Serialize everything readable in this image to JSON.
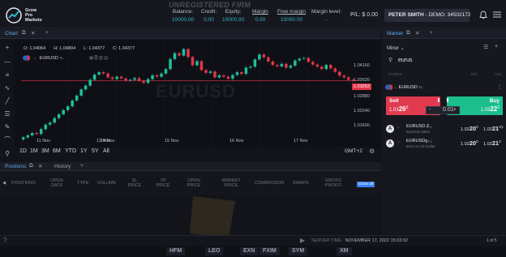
{
  "header": {
    "logo_text": [
      "Grow",
      "Pro",
      "Markets"
    ],
    "watermark": "UNREGISTERED FIRM",
    "stats": [
      {
        "label": "Balance:",
        "value": "10000.00"
      },
      {
        "label": "Credit:",
        "value": "0.00"
      },
      {
        "label": "Equity:",
        "value": "10000.00"
      },
      {
        "label": "Margin",
        "value": "0.00"
      },
      {
        "label": "Free margin",
        "value": "10000.00"
      },
      {
        "label": "Margin level:",
        "value": "-"
      }
    ],
    "pl_label": "P/L:",
    "pl_value": "$ 0.00",
    "account_name": "PETER SMITH",
    "account_sep": " - ",
    "account_type": "DEMO: 34502172"
  },
  "chart_panel": {
    "tab_label": "Chart",
    "ohlc": {
      "o": "O: 1.04064",
      "h": "H: 1.04804",
      "l": "L: 1.04377",
      "c": "C: 1.04377"
    },
    "symbol": "EURUSD",
    "symbol_suffix": "FL",
    "watermark": "EURUSD",
    "current_price": "1.03263",
    "timeframes": [
      "1D",
      "1M",
      "3M",
      "6M",
      "YTD",
      "1Y",
      "5Y",
      "All"
    ],
    "timezone": "GMT+2"
  },
  "chart_data": {
    "type": "candlestick",
    "yticks": [
      "1.04160",
      "1.03520",
      "1.02880",
      "1.02240",
      "1.01600"
    ],
    "xticks": [
      "11 Nov",
      "13 Nov",
      "14 Nov",
      "15 Nov",
      "16 Nov",
      "17 Nov"
    ],
    "ylim": [
      1.0135,
      1.0445
    ],
    "current_price": 1.03263,
    "close_series": [
      1.0162,
      1.0168,
      1.0175,
      1.0172,
      1.0186,
      1.0199,
      1.0205,
      1.0218,
      1.0229,
      1.0241,
      1.0252,
      1.0269,
      1.0283,
      1.0301,
      1.0312,
      1.0329,
      1.0344,
      1.0351,
      1.0347,
      1.0336,
      1.0331,
      1.0338,
      1.0333,
      1.0327,
      1.0329,
      1.0334,
      1.0326,
      1.032,
      1.0331,
      1.0342,
      1.0338,
      1.0347,
      1.036,
      1.0389,
      1.0406,
      1.0399,
      1.0418,
      1.0395,
      1.0371,
      1.0383,
      1.0357,
      1.0349,
      1.0353,
      1.0336,
      1.0342,
      1.0338,
      1.0332,
      1.0343,
      1.0351,
      1.0346,
      1.0364,
      1.0367,
      1.0388,
      1.0402,
      1.0394,
      1.0382,
      1.0372,
      1.0368,
      1.0375,
      1.0364,
      1.037,
      1.0385,
      1.039,
      1.0392,
      1.0381,
      1.0373,
      1.0367,
      1.036,
      1.0372,
      1.0362,
      1.0352,
      1.0341,
      1.0336,
      1.0329,
      1.0326
    ]
  },
  "positions_panel": {
    "tabs": [
      "Positions",
      "History"
    ],
    "columns": [
      "POSITIONS",
      "OPEN DATE",
      "TYPE",
      "VOLUME",
      "SL PRICE",
      "TP PRICE",
      "OPEN PRICE",
      "MARKET PRICE",
      "COMMISSION",
      "SWAPS",
      "GROSS PROFIT"
    ],
    "close_all_label": "Close all"
  },
  "market_panel": {
    "tab_label": "Market",
    "view_label": "Minor",
    "search_value": "eurus",
    "headers": {
      "symbol": "SYMBOL",
      "bid": "BID",
      "ask": "ASK"
    },
    "selected": {
      "symbol": "EURUSD",
      "suffix": "FL",
      "sell_label": "Sell",
      "buy_label": "Buy",
      "sell_price_prefix": "1.03",
      "sell_price_big": "26",
      "sell_price_sup": "0",
      "buy_price_prefix": "1.03",
      "buy_price_big": "22",
      "buy_price_sup": "3",
      "quantity": "0.01"
    },
    "items": [
      {
        "symbol": "EURUSD.Z",
        "suffix": "FL",
        "sub": "Euro/US dollar",
        "bid_prefix": "1.02",
        "bid_big": "20",
        "bid_sup": "0",
        "ask_prefix": "1.02",
        "ask_big": "21",
        "ask_sup": "3"
      },
      {
        "symbol": "EURUSDg",
        "suffix": "FL",
        "sub": "Euro vs US Dollar",
        "bid_prefix": "1.02",
        "bid_big": "20",
        "bid_sup": "0",
        "ask_prefix": "1.02",
        "ask_big": "21",
        "ask_sup": "3"
      }
    ]
  },
  "status": {
    "server_label": "SERVER TIME:",
    "server_time": "NOVEMBER 17, 2022 15:03:02",
    "page": "1 of 5"
  },
  "brands": [
    "HFM",
    "LEO",
    "EXN",
    "FXIM",
    "SYM",
    "XM"
  ]
}
